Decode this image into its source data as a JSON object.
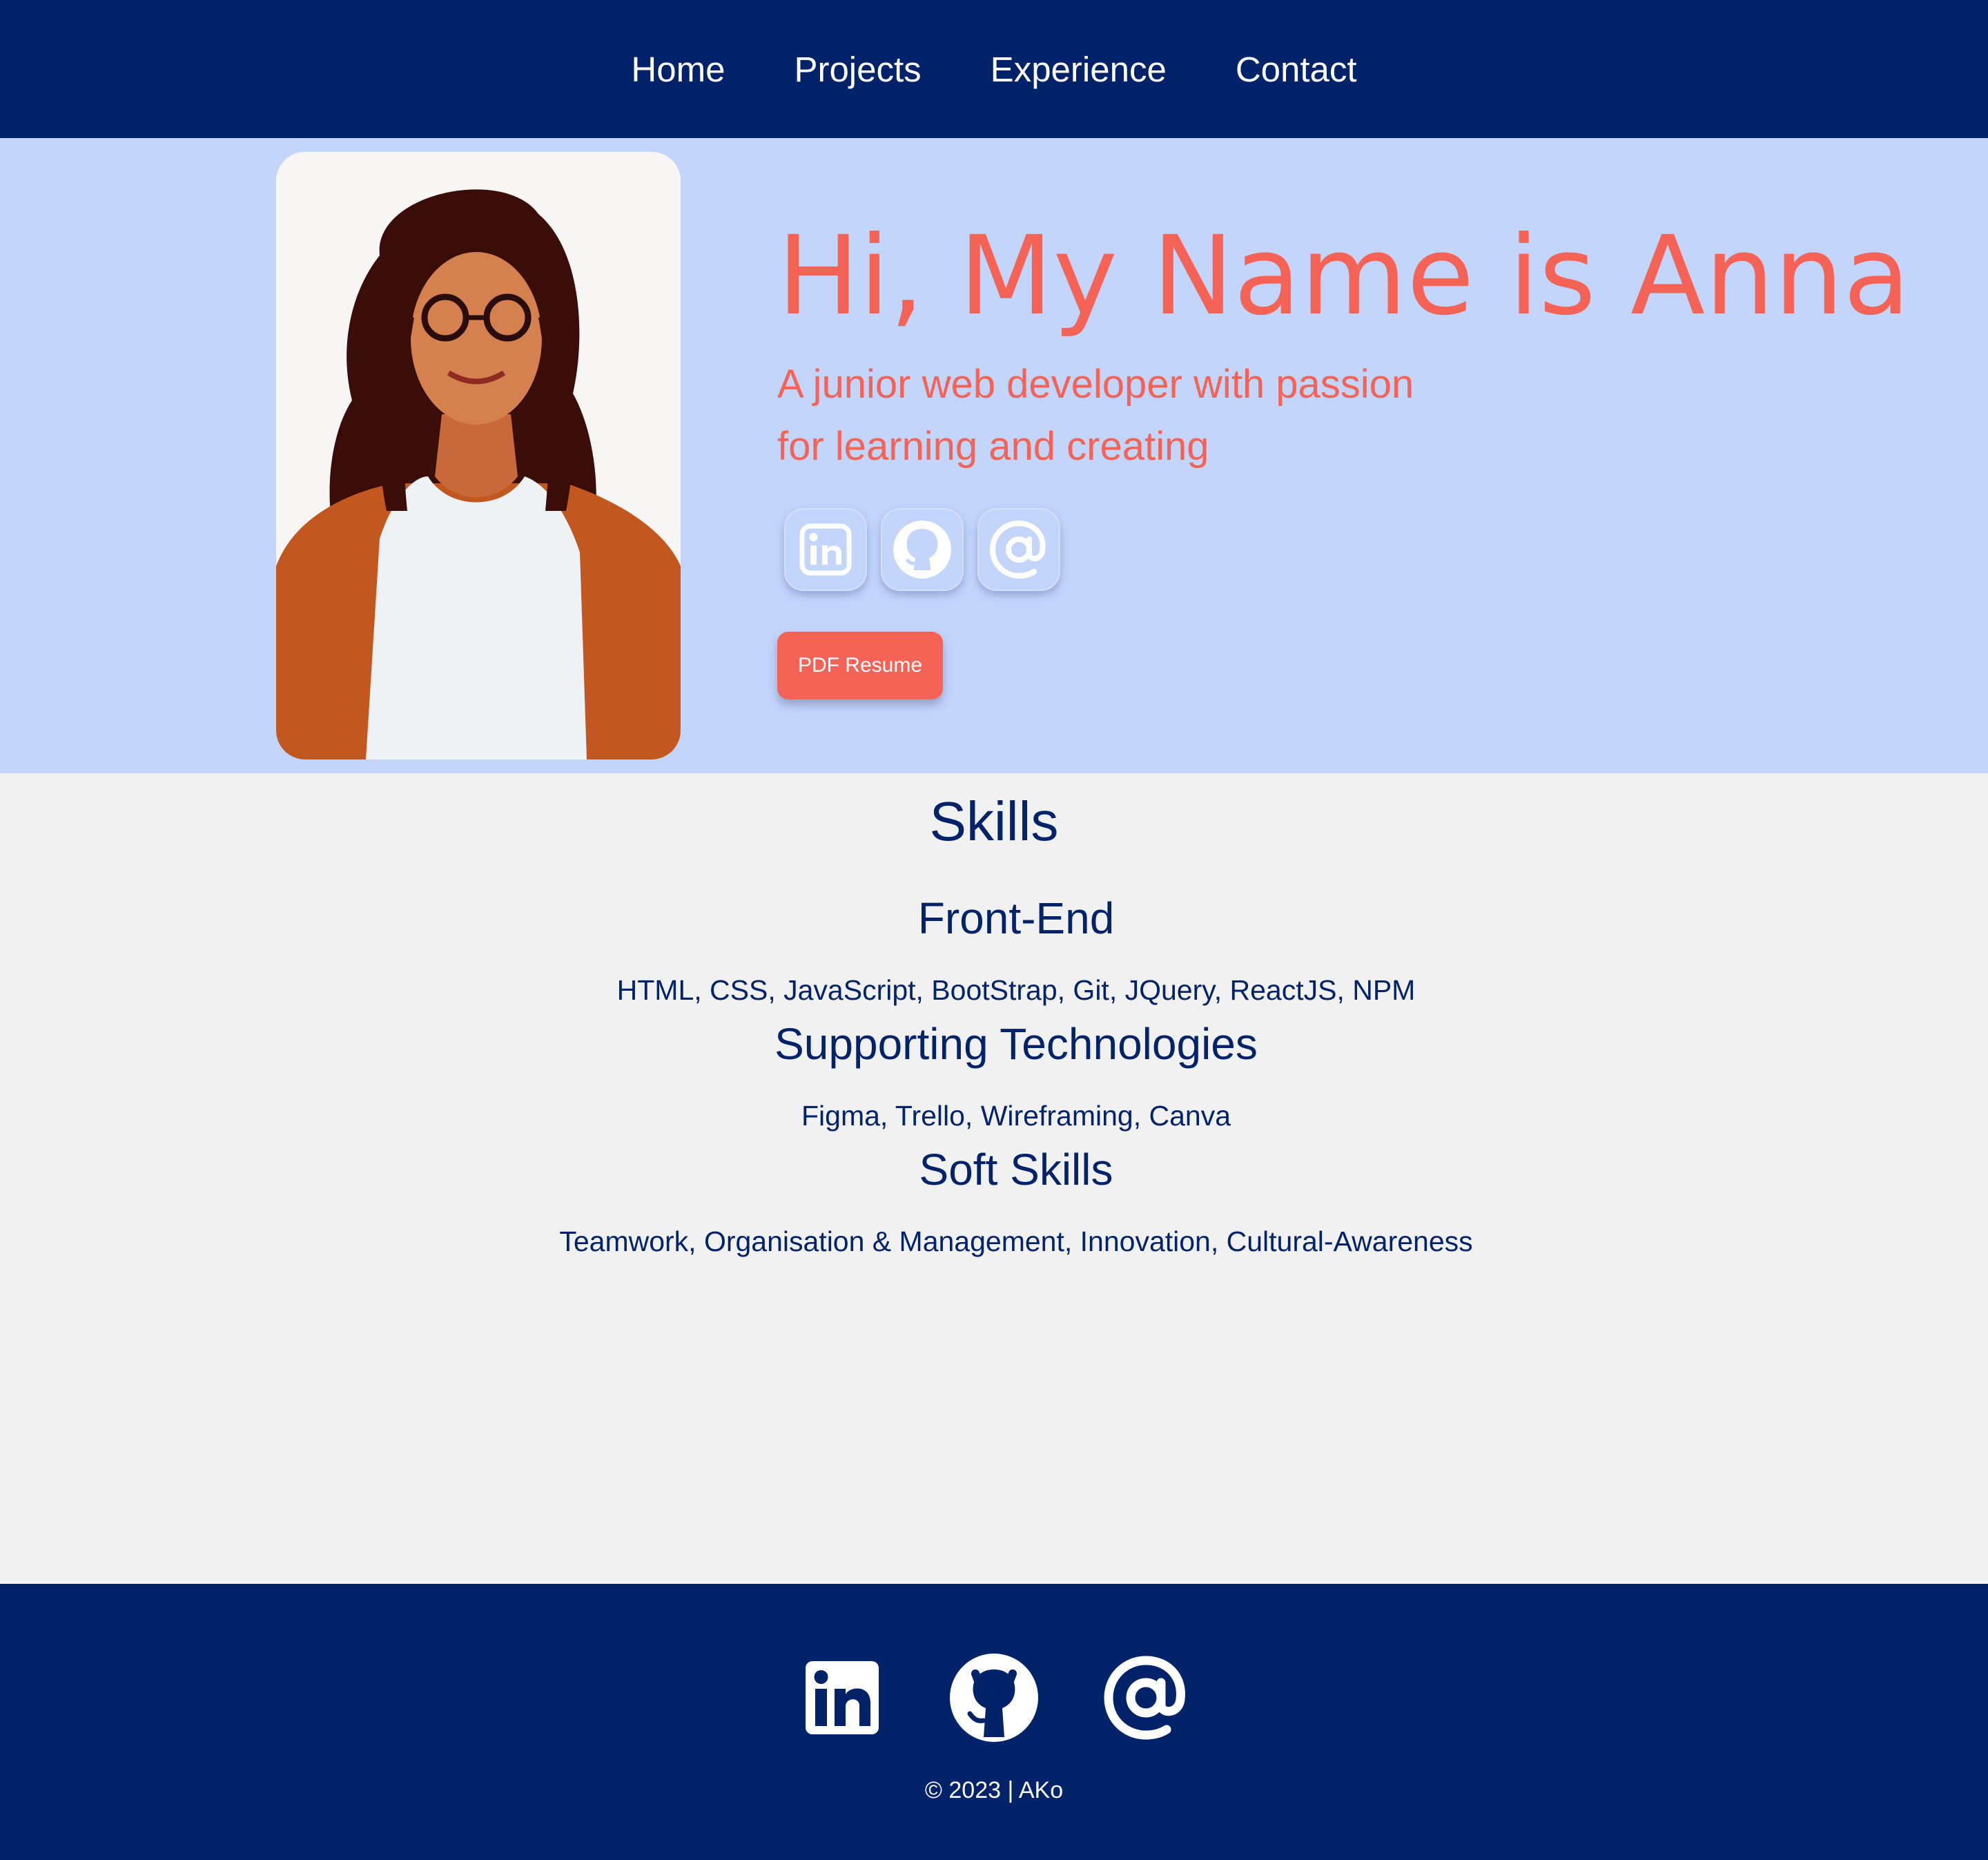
{
  "nav": {
    "items": [
      {
        "label": "Home"
      },
      {
        "label": "Projects"
      },
      {
        "label": "Experience"
      },
      {
        "label": "Contact"
      }
    ]
  },
  "hero": {
    "title": "Hi, My Name is Anna",
    "subtitle_line1": "A junior web developer with passion",
    "subtitle_line2": "for learning and creating",
    "social_icons": [
      "linkedin-icon",
      "github-icon",
      "at-sign-icon"
    ],
    "resume_button": "PDF Resume"
  },
  "skills": {
    "title": "Skills",
    "categories": [
      {
        "name": "Front-End",
        "items": "HTML, CSS, JavaScript, BootStrap, Git, JQuery, ReactJS, NPM"
      },
      {
        "name": "Supporting Technologies",
        "items": "Figma, Trello, Wireframing, Canva"
      },
      {
        "name": "Soft Skills",
        "items": "Teamwork, Organisation & Management, Innovation, Cultural-Awareness"
      }
    ]
  },
  "footer": {
    "social_icons": [
      "linkedin-icon",
      "github-icon",
      "at-sign-icon"
    ],
    "copyright": "© 2023 | AKo"
  },
  "colors": {
    "navy": "#02226a",
    "hero_bg": "#c4d5fc",
    "accent": "#f46355",
    "page_bg": "#f1f1f1"
  }
}
